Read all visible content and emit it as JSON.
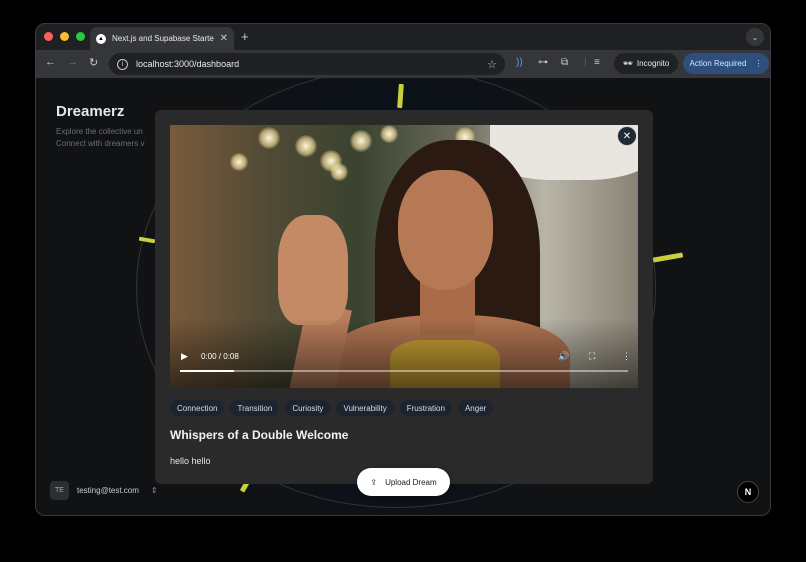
{
  "browser": {
    "tab_title": "Next.js and Supabase Starter",
    "url": "localhost:3000/dashboard",
    "incognito_label": "Incognito",
    "action_label": "Action Required"
  },
  "app": {
    "title": "Dreamerz",
    "subtitle_line1": "Explore the collective un",
    "subtitle_line2": "Connect with dreamers v",
    "user_initials": "TE",
    "user_email": "testing@test.com",
    "upload_label": "Upload Dream",
    "brand_letter": "N"
  },
  "modal": {
    "video_time": "0:00 / 0:08",
    "video_progress": 0.12,
    "tags": [
      "Connection",
      "Transition",
      "Curiosity",
      "Vulnerability",
      "Frustration",
      "Anger"
    ],
    "title": "Whispers of a Double Welcome",
    "description": "hello hello"
  },
  "colors": {
    "accent_bar": "#c8cf3a",
    "chip_bg": "#1d2430",
    "modal_bg": "#2a2a2b"
  }
}
